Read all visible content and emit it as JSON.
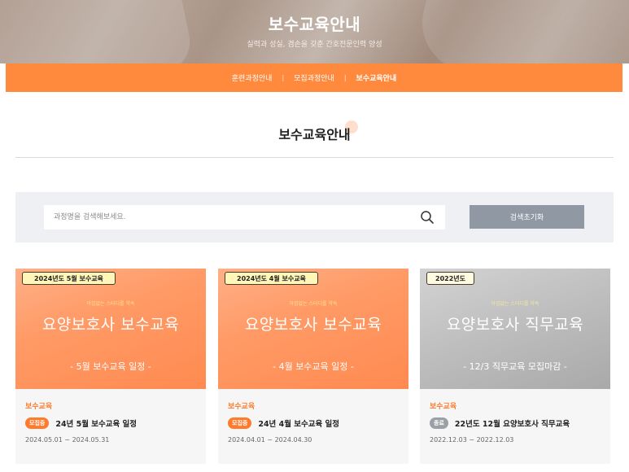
{
  "hero": {
    "title": "보수교육안내",
    "subtitle": "실력과 성실, 겸손을 갖춘 간호전문인력 양성"
  },
  "nav": {
    "items": [
      {
        "label": "훈련과정안내",
        "active": false
      },
      {
        "label": "모집과정안내",
        "active": false
      },
      {
        "label": "보수교육안내",
        "active": true
      }
    ],
    "separator": "|"
  },
  "page_title": "보수교육안내",
  "search": {
    "placeholder": "과정명을 검색해보세요.",
    "value": "",
    "reset_label": "검색초기화"
  },
  "cards": [
    {
      "theme": "orange",
      "tag": "2024년도 5월 보수교육",
      "tagline": "아낌없는 스터디를 약속",
      "big_title": "요양보호사 보수교육",
      "sub_title": "- 5월 보수교육 일정 -",
      "category": "보수교육",
      "status": "모집중",
      "course_title": "24년 5월 보수교육 일정",
      "dates": "2024.05.01 ~ 2024.05.31"
    },
    {
      "theme": "orange",
      "tag": "2024년도 4월 보수교육",
      "tagline": "아낌없는 스터디를 약속",
      "big_title": "요양보호사 보수교육",
      "sub_title": "- 4월 보수교육 일정 -",
      "category": "보수교육",
      "status": "모집중",
      "course_title": "24년 4월 보수교육 일정",
      "dates": "2024.04.01 ~ 2024.04.30"
    },
    {
      "theme": "gray",
      "tag": "2022년도",
      "tagline": "아낌없는 스터디를 약속",
      "big_title": "요양보호사 직무교육",
      "sub_title": "- 12/3 직무교육 모집마감 -",
      "category": "보수교육",
      "status": "종료",
      "course_title": "22년도 12월 요양보호사 직무교육",
      "dates": "2022.12.03 ~ 2022.12.03"
    }
  ],
  "colors": {
    "accent": "#ff8a3d",
    "status_open": "#ff7a2a",
    "status_closed": "#9aa0a6",
    "reset_button": "#8f98a3"
  },
  "icons": {
    "search": "search-icon"
  }
}
